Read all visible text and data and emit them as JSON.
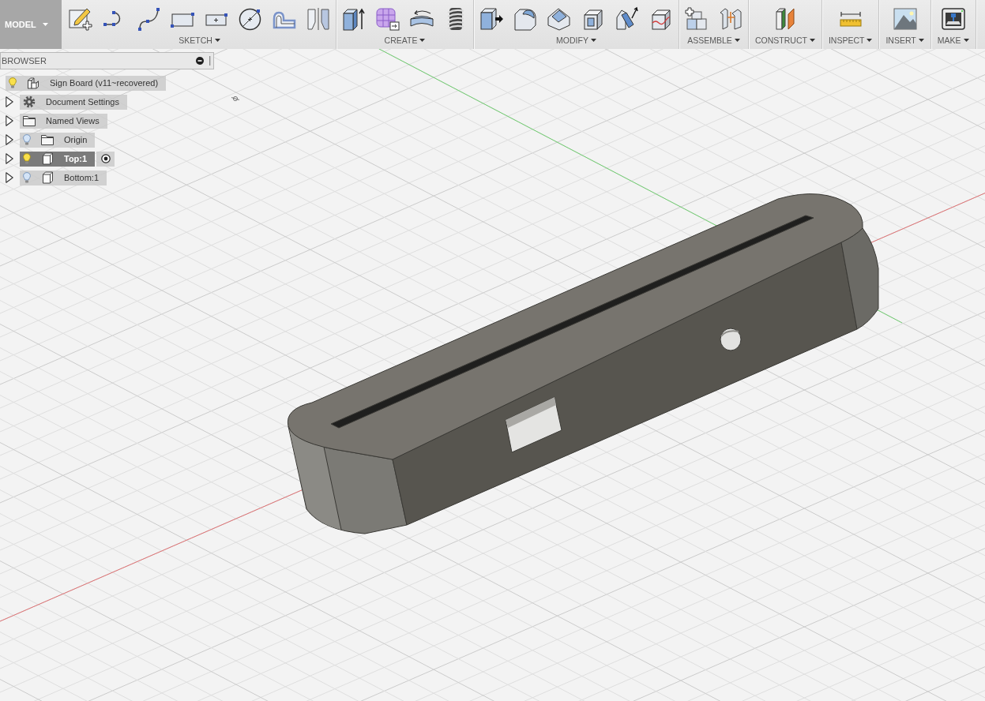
{
  "workspace": {
    "label": "MODEL"
  },
  "toolbar": {
    "groups": [
      {
        "label": "SKETCH",
        "tools": [
          {
            "kind": "sketch"
          },
          {
            "kind": "arc"
          },
          {
            "kind": "spline"
          },
          {
            "kind": "rectangle"
          },
          {
            "kind": "centerbox"
          },
          {
            "kind": "circle"
          },
          {
            "kind": "offset"
          },
          {
            "kind": "mirror"
          }
        ]
      },
      {
        "label": "CREATE",
        "tools": [
          {
            "kind": "extrude"
          },
          {
            "kind": "form"
          },
          {
            "kind": "revolve"
          },
          {
            "kind": "coil"
          }
        ]
      },
      {
        "label": "MODIFY",
        "tools": [
          {
            "kind": "presspull"
          },
          {
            "kind": "fillet"
          },
          {
            "kind": "chamfer"
          },
          {
            "kind": "shell"
          },
          {
            "kind": "draft"
          },
          {
            "kind": "split"
          }
        ]
      },
      {
        "label": "ASSEMBLE",
        "tools": [
          {
            "kind": "component"
          },
          {
            "kind": "joint"
          }
        ]
      },
      {
        "label": "CONSTRUCT",
        "tools": [
          {
            "kind": "plane"
          }
        ]
      },
      {
        "label": "INSPECT",
        "tools": [
          {
            "kind": "measure"
          }
        ]
      },
      {
        "label": "INSERT",
        "tools": [
          {
            "kind": "image"
          }
        ]
      },
      {
        "label": "MAKE",
        "tools": [
          {
            "kind": "printer"
          }
        ]
      }
    ]
  },
  "browser": {
    "title": "BROWSER",
    "root": {
      "label": "Sign Board (v11~recovered)",
      "kind": "assembly",
      "lit": true,
      "selected": false,
      "children": [
        {
          "label": "Document Settings",
          "kind": "settings",
          "expanded": false,
          "selected": false,
          "activated": false
        },
        {
          "label": "Named Views",
          "kind": "folder",
          "expanded": false,
          "selected": false,
          "activated": false
        },
        {
          "label": "Origin",
          "kind": "folder",
          "lit": false,
          "expanded": false,
          "selected": false,
          "activated": false
        },
        {
          "label": "Top:1",
          "kind": "component",
          "lit": true,
          "expanded": false,
          "selected": true,
          "activated": true
        },
        {
          "label": "Bottom:1",
          "kind": "component",
          "lit": false,
          "expanded": false,
          "selected": false,
          "activated": false
        }
      ]
    }
  }
}
